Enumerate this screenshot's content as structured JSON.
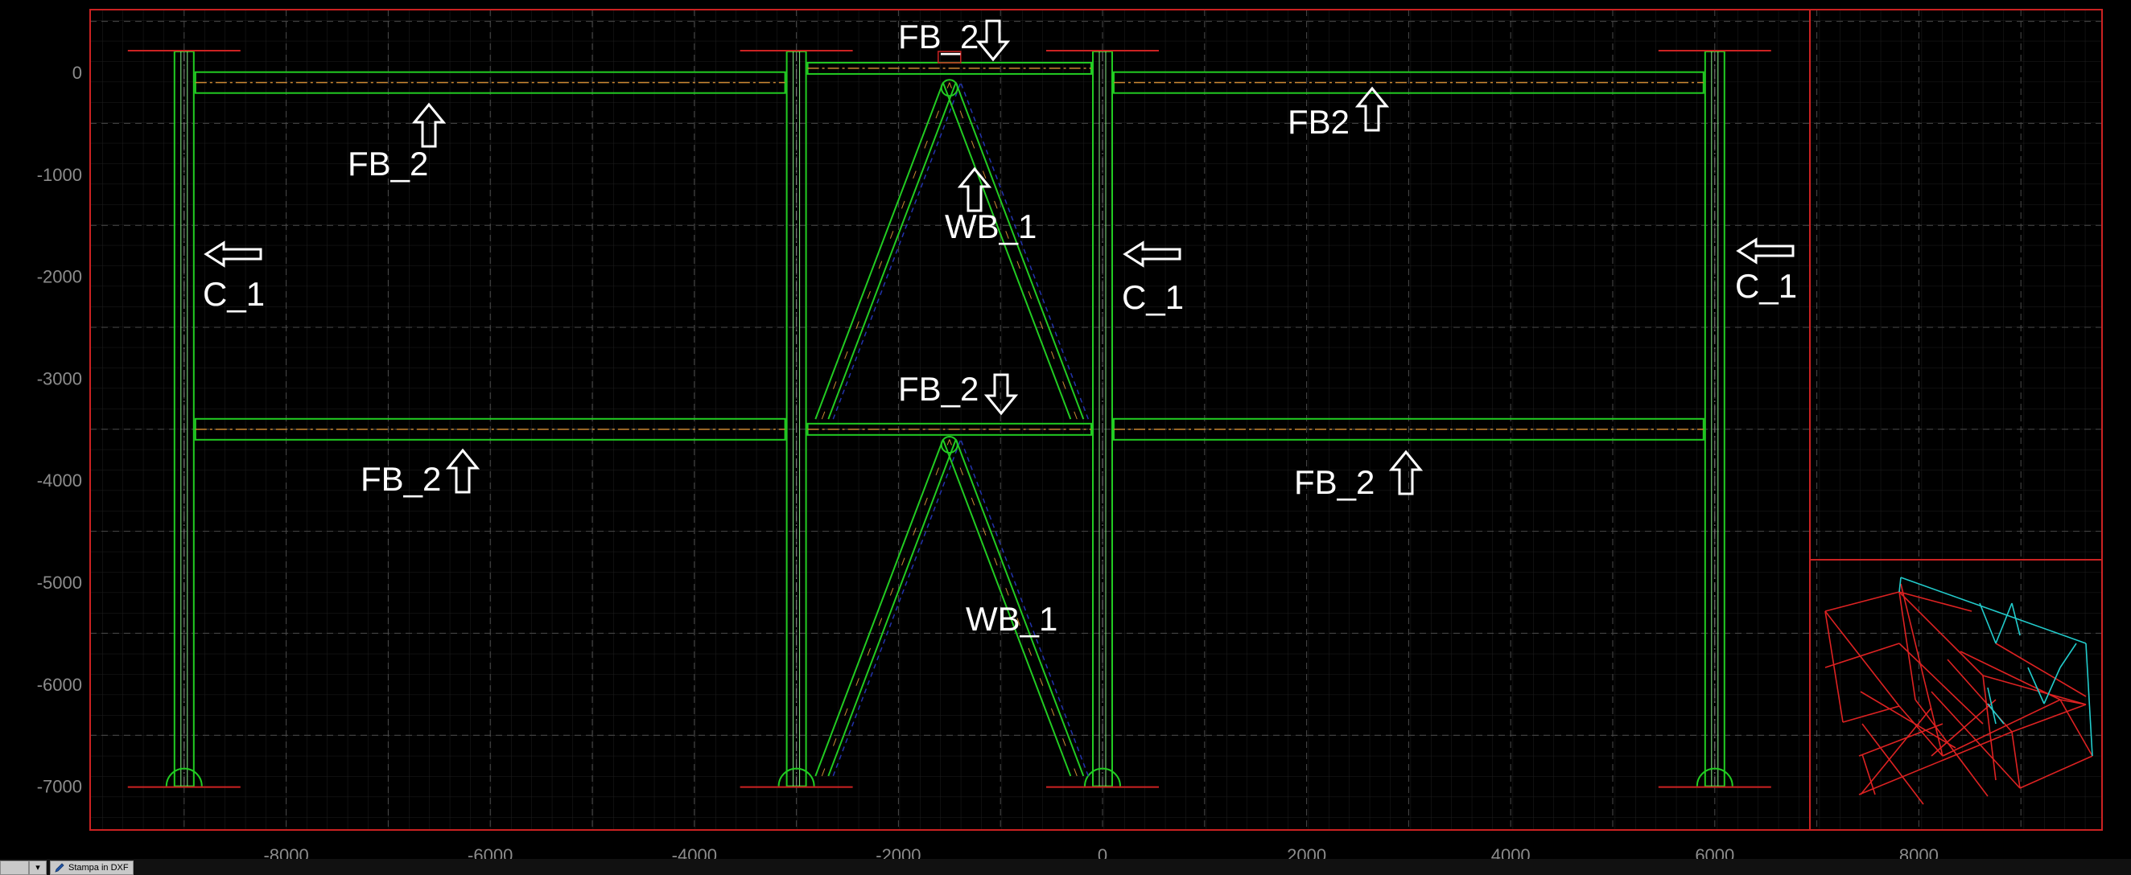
{
  "view": {
    "title": "",
    "colors": {
      "background": "#000000",
      "grid_major": "#4a4a4a",
      "grid_minor": "#1e1e1e",
      "frame_border": "#cc2222",
      "member": "#22cc22",
      "member_secondary": "#88ee88",
      "node_line": "#cc8833",
      "axis_text": "#8c8c8c",
      "label_text": "#ffffff",
      "support": "#cc2222",
      "brace_hidden": "#2233aa",
      "mini_red": "#dd2222",
      "mini_cyan": "#22cccc"
    }
  },
  "axes": {
    "x_ticks": [
      "-8000",
      "-6000",
      "-4000",
      "-2000",
      "0",
      "2000",
      "4000",
      "6000",
      "8000"
    ],
    "y_ticks": [
      "0",
      "-1000",
      "-2000",
      "-3000",
      "-4000",
      "-5000",
      "-6000",
      "-7000"
    ]
  },
  "labels": [
    {
      "id": "fb2-top-center",
      "text": "FB_2"
    },
    {
      "id": "fb2-top-left",
      "text": "FB_2"
    },
    {
      "id": "fb2-top-right",
      "text": "FB2"
    },
    {
      "id": "wb1-upper",
      "text": "WB_1"
    },
    {
      "id": "c1-left",
      "text": "C_1"
    },
    {
      "id": "c1-middle",
      "text": "C_1"
    },
    {
      "id": "c1-right",
      "text": "C_1"
    },
    {
      "id": "fb2-mid-center",
      "text": "FB_2"
    },
    {
      "id": "fb2-lower-left",
      "text": "FB_2"
    },
    {
      "id": "fb2-lower-right",
      "text": "FB_2"
    },
    {
      "id": "wb1-lower",
      "text": "WB_1"
    }
  ],
  "toolbar": {
    "dropdown_value": "",
    "dropdown_icon": "chevron-down-icon",
    "print_label": "Stampa in DXF",
    "print_icon": "pencil-icon"
  }
}
